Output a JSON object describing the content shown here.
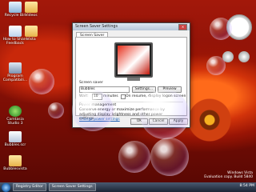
{
  "desktop_icons": [
    {
      "label": "Recycle Bin"
    },
    {
      "label": "Videos"
    },
    {
      "label": "How to Share Feedback"
    },
    {
      "label": "Vista"
    },
    {
      "label": "Program Compatibili..."
    },
    {
      "label": "Camtasia Studio 3"
    },
    {
      "label": "Bubbles.scr"
    },
    {
      "label": "Bubblesvista"
    }
  ],
  "window": {
    "title": "Screen Saver Settings",
    "tab": "Screen Saver",
    "screensaver_label": "Screen saver",
    "screensaver_value": "Bubbles",
    "settings_btn": "Settings...",
    "preview_btn": "Preview",
    "wait_label": "Wait:",
    "wait_value": "10",
    "minutes_label": "minutes",
    "resume_label": "On resume, display logon screen",
    "power_title": "Power management",
    "power_text": "Conserve energy or maximize performance by adjusting display brightness and other power settings.",
    "power_link": "Change power settings",
    "ok_btn": "OK",
    "cancel_btn": "Cancel",
    "apply_btn": "Apply"
  },
  "taskbar": {
    "items": [
      {
        "label": "Registry Editor"
      },
      {
        "label": "Screen Saver Settings"
      }
    ],
    "time": "8:54 PM"
  },
  "watermark": {
    "line1": "Windows Vista",
    "line2": "Evaluation copy. Build 5840"
  }
}
